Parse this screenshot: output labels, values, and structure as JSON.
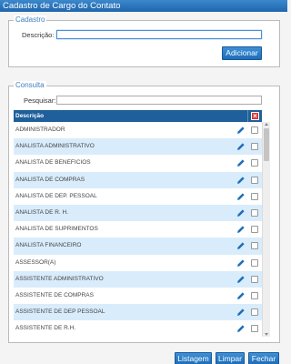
{
  "window": {
    "title": "Cadastro de Cargo do Contato"
  },
  "cadastro": {
    "legend": "Cadastro",
    "descricao_label": "Descrição:",
    "descricao_value": "",
    "add_button": "Adicionar"
  },
  "consulta": {
    "legend": "Consulta",
    "search_label": "Pesquisar:",
    "search_value": "",
    "column_header": "Descrição",
    "delete_all_icon": "×",
    "rows": [
      "ADMINISTRADOR",
      "ANALISTA ADMINISTRATIVO",
      "ANALISTA DE BENEFICIOS",
      "ANALISTA DE COMPRAS",
      "ANALISTA DE DEP. PESSOAL",
      "ANALISTA DE R. H.",
      "ANALISTA DE SUPRIMENTOS",
      "ANALISTA FINANCEIRO",
      "ASSESSOR(A)",
      "ASSISTENTE ADMINISTRATIVO",
      "ASSISTENTE DE COMPRAS",
      "ASSISTENTE DE DEP PESSOAL",
      "ASSISTENTE DE R.H."
    ]
  },
  "footer": {
    "listagem": "Listagem",
    "limpar": "Limpar",
    "fechar": "Fechar"
  },
  "colors": {
    "title_bar": "#1f66ad",
    "grid_header": "#1e5f9c",
    "row_alt": "#d9ecfb",
    "button": "#1e6db9",
    "edit_icon": "#1f6fb8",
    "delete_icon": "#d63a3a"
  }
}
